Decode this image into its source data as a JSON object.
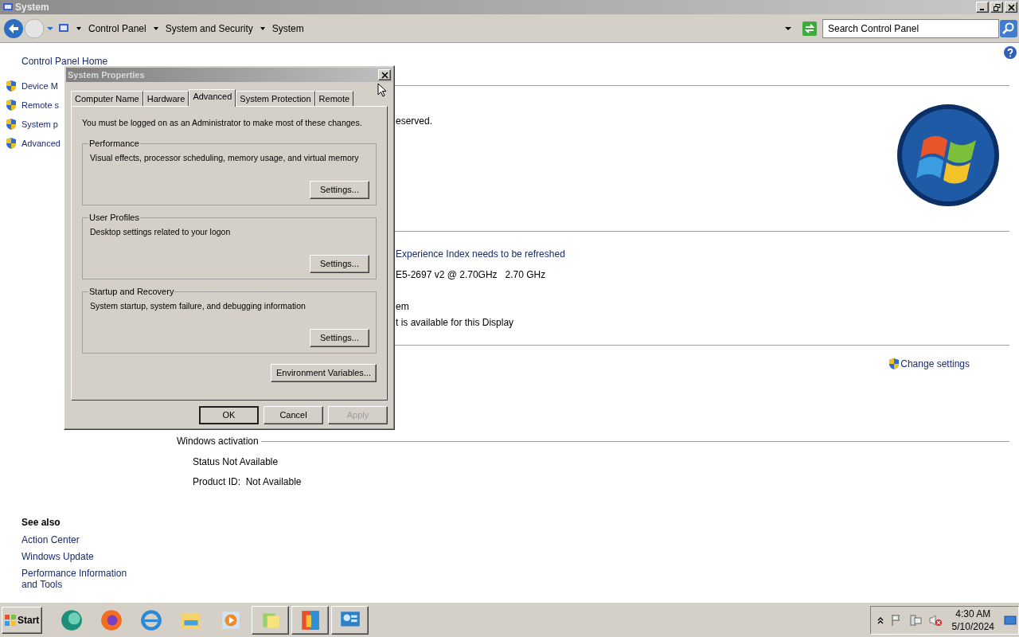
{
  "window": {
    "title": "System"
  },
  "address_bar": {
    "breadcrumb": [
      "Control Panel",
      "System and Security",
      "System"
    ],
    "search": {
      "placeholder": "Search Control Panel"
    }
  },
  "sidebar": {
    "home": "Control Panel Home",
    "items": [
      "Device M",
      "Remote s",
      "System p",
      "Advanced"
    ],
    "see_also": {
      "title": "See also",
      "links": [
        "Action Center",
        "Windows Update",
        "Performance Information and Tools"
      ]
    }
  },
  "main": {
    "partial_lines": [
      {
        "kind": "text",
        "text": "eserved."
      },
      {
        "kind": "link",
        "text": "Experience Index needs to be refreshed"
      },
      {
        "kind": "text",
        "text": "E5-2697 v2 @ 2.70GHz   2.70 GHz"
      },
      {
        "kind": "text",
        "text": "em"
      },
      {
        "kind": "text",
        "text": "t is available for this Display"
      }
    ],
    "change_settings": "Change settings",
    "activation": {
      "title": "Windows activation",
      "status": "Status Not Available",
      "product_id": "Product ID:  Not Available"
    }
  },
  "dialog": {
    "title": "System Properties",
    "tabs": [
      {
        "label": "Computer Name",
        "selected": false
      },
      {
        "label": "Hardware",
        "selected": false
      },
      {
        "label": "Advanced",
        "selected": true
      },
      {
        "label": "System Protection",
        "selected": false
      },
      {
        "label": "Remote",
        "selected": false
      }
    ],
    "notice": "You must be logged on as an Administrator to make most of these changes.",
    "groups": [
      {
        "title": "Performance",
        "description": "Visual effects, processor scheduling, memory usage, and virtual memory",
        "button": "Settings..."
      },
      {
        "title": "User Profiles",
        "description": "Desktop settings related to your logon",
        "button": "Settings..."
      },
      {
        "title": "Startup and Recovery",
        "description": "System startup, system failure, and debugging information",
        "button": "Settings..."
      }
    ],
    "environment_button": "Environment Variables...",
    "buttons": [
      {
        "label": "OK",
        "default": true,
        "disabled": false
      },
      {
        "label": "Cancel",
        "default": false,
        "disabled": false
      },
      {
        "label": "Apply",
        "default": false,
        "disabled": true
      }
    ]
  },
  "taskbar": {
    "start": "Start",
    "apps": [
      {
        "running": false
      },
      {
        "running": false
      },
      {
        "running": false
      },
      {
        "running": false
      },
      {
        "running": false
      },
      {
        "running": true
      },
      {
        "running": true
      },
      {
        "running": true
      }
    ],
    "clock": {
      "time": "4:30 AM",
      "date": "5/10/2024"
    }
  }
}
